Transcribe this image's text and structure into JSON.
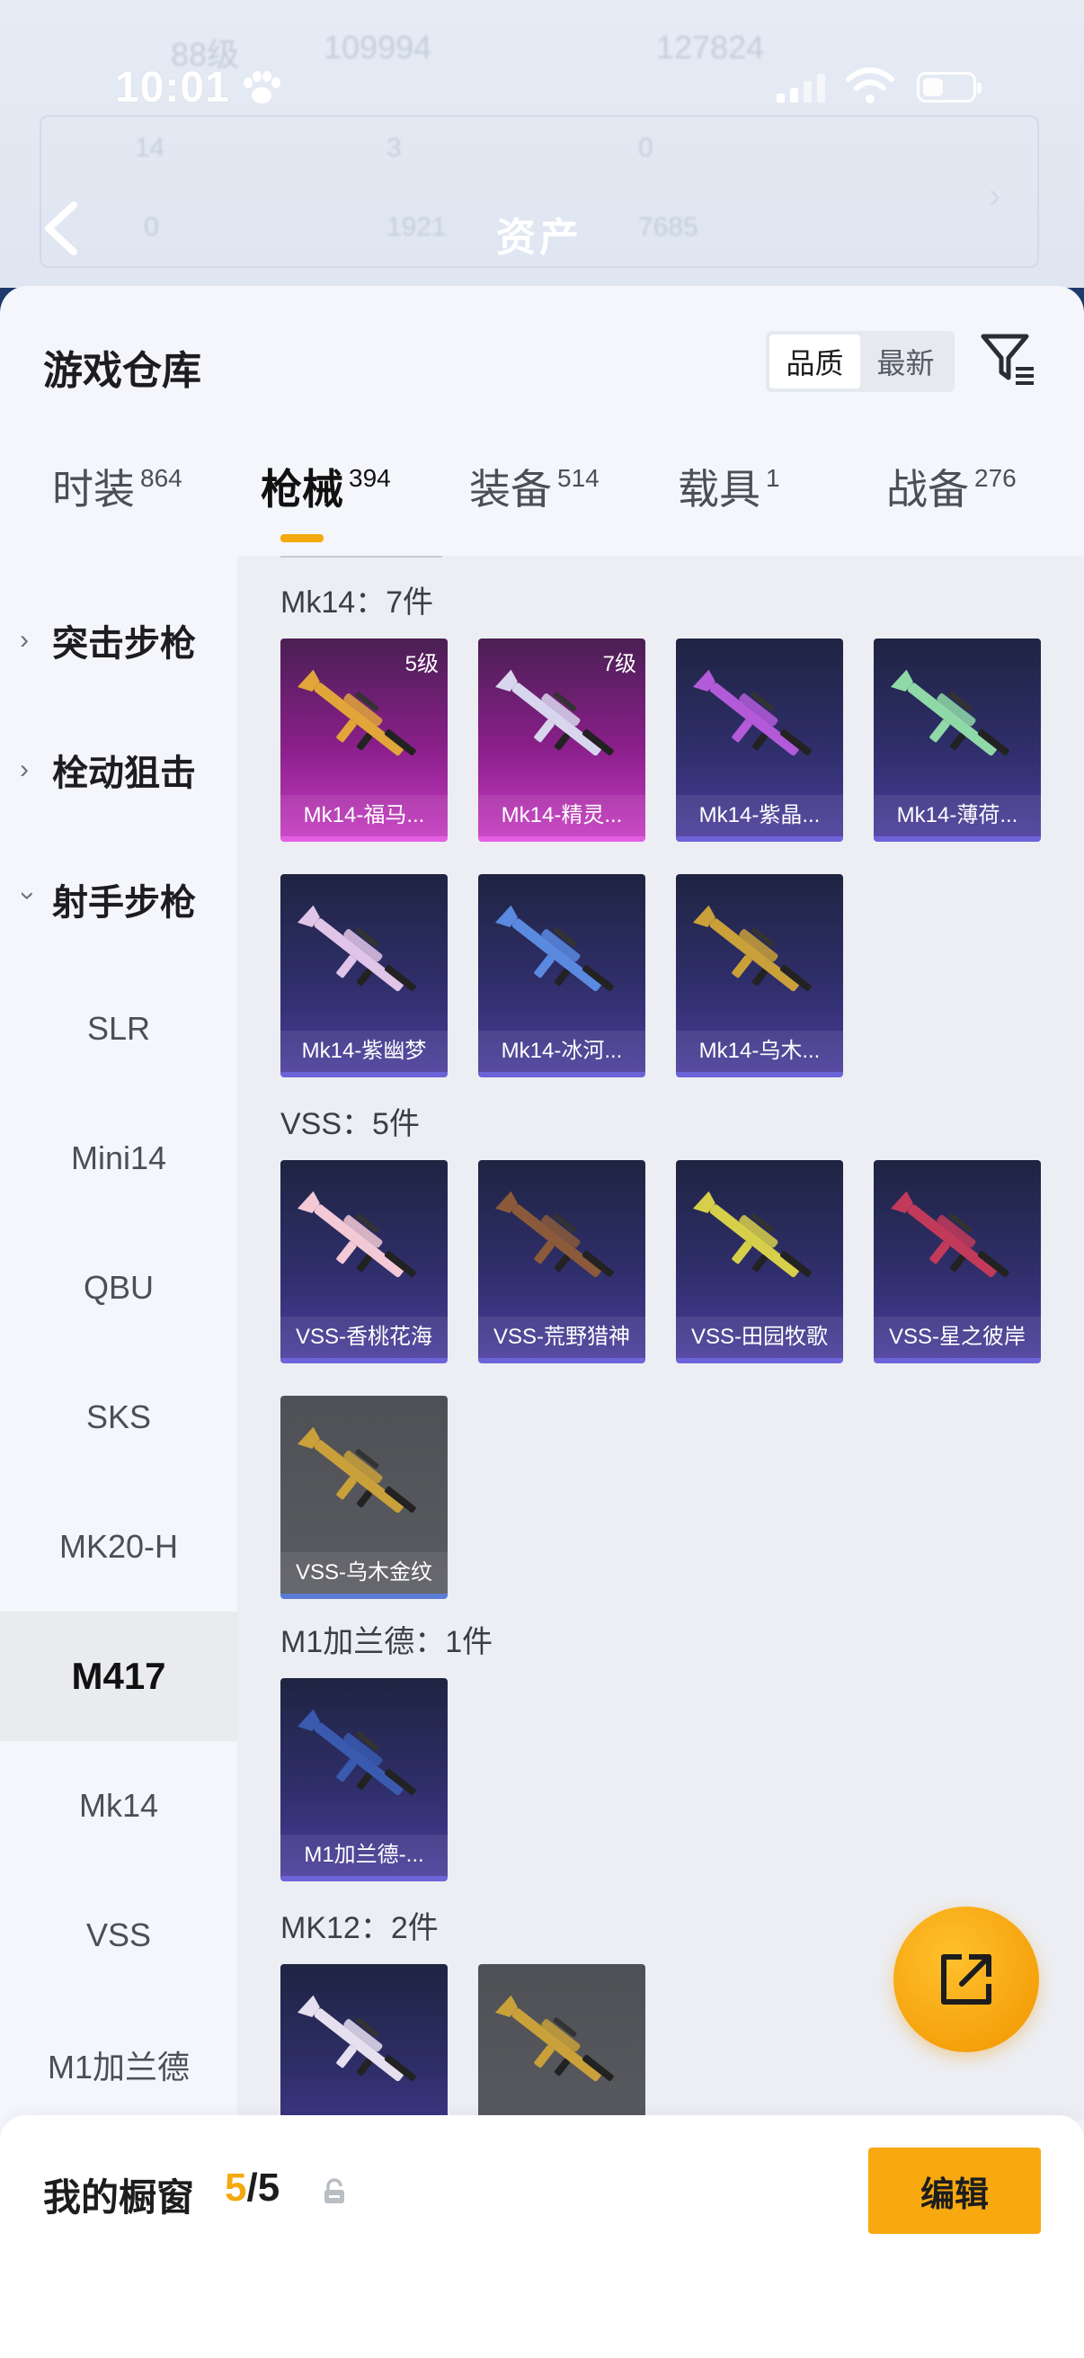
{
  "status": {
    "time": "10:01"
  },
  "background_header": {
    "title": "资产",
    "blur_level": "88级",
    "blur_num_a": "109994",
    "blur_num_b": "127824",
    "blur_stat_1": "14",
    "blur_stat_2": "3",
    "blur_stat_3": "0",
    "blur_stat_4": "0",
    "blur_stat_5": "1921",
    "blur_stat_6": "7685"
  },
  "sheet": {
    "title": "游戏仓库",
    "sort_options": [
      "品质",
      "最新"
    ],
    "sort_active": "品质"
  },
  "categories": [
    {
      "label": "时装",
      "count": "864"
    },
    {
      "label": "枪械",
      "count": "394",
      "active": true
    },
    {
      "label": "装备",
      "count": "514"
    },
    {
      "label": "载具",
      "count": "1"
    },
    {
      "label": "战备",
      "count": "276"
    }
  ],
  "sidebar": {
    "groups": [
      "突击步枪",
      "栓动狙击",
      "射手步枪"
    ],
    "items": [
      "SLR",
      "Mini14",
      "QBU",
      "SKS",
      "MK20-H",
      "M417",
      "Mk14",
      "VSS",
      "M1加兰德"
    ],
    "active_item": "M417"
  },
  "sections": [
    {
      "title": "Mk14：7件",
      "items": [
        {
          "name": "Mk14-福马...",
          "level": "5级",
          "rarity": "legend",
          "color": "#e1a53a"
        },
        {
          "name": "Mk14-精灵...",
          "level": "7级",
          "rarity": "legend",
          "color": "#d8d6ee"
        },
        {
          "name": "Mk14-紫晶...",
          "rarity": "epic",
          "color": "#b35ad9"
        },
        {
          "name": "Mk14-薄荷...",
          "rarity": "epic",
          "color": "#8fd9a8"
        },
        {
          "name": "Mk14-紫幽梦",
          "rarity": "epic",
          "color": "#e0c5e8"
        },
        {
          "name": "Mk14-冰河...",
          "rarity": "epic",
          "color": "#5a8ae0"
        },
        {
          "name": "Mk14-乌木...",
          "rarity": "epic",
          "color": "#c9a03a"
        }
      ]
    },
    {
      "title": "VSS：5件",
      "items": [
        {
          "name": "VSS-香桃花海",
          "rarity": "epic",
          "color": "#f3c9d6"
        },
        {
          "name": "VSS-荒野猎神",
          "rarity": "epic",
          "color": "#8a5a3a"
        },
        {
          "name": "VSS-田园牧歌",
          "rarity": "epic",
          "color": "#d6cf4a"
        },
        {
          "name": "VSS-星之彼岸",
          "rarity": "epic",
          "color": "#c23a5a"
        },
        {
          "name": "VSS-乌木金纹",
          "rarity": "grey",
          "color": "#c9a03a"
        }
      ]
    },
    {
      "title": "M1加兰德：1件",
      "items": [
        {
          "name": "M1加兰德-...",
          "rarity": "epic",
          "color": "#3a5ab0"
        }
      ]
    },
    {
      "title": "MK12：2件",
      "items": [
        {
          "name": "",
          "rarity": "epic",
          "color": "#e5dff0"
        },
        {
          "name": "",
          "rarity": "grey",
          "color": "#c9a03a"
        }
      ]
    }
  ],
  "showcase": {
    "title": "我的橱窗",
    "current": "5",
    "total": "/5",
    "edit_label": "编辑"
  }
}
